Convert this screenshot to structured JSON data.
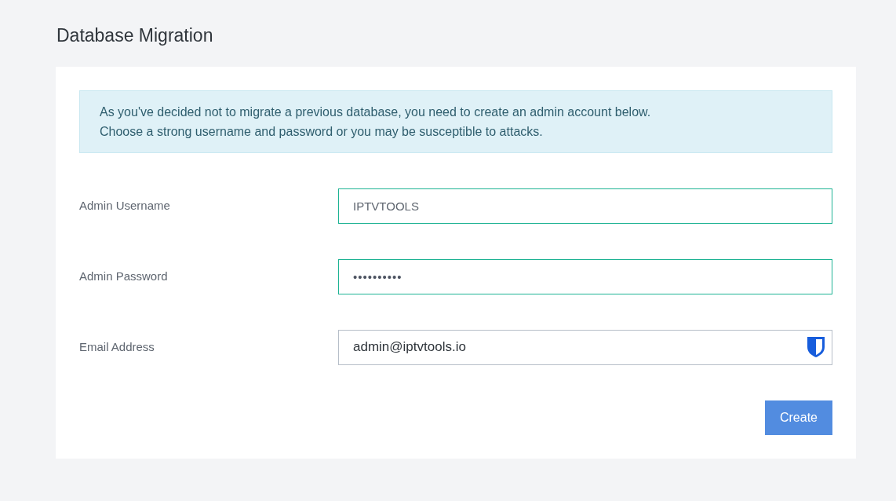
{
  "page": {
    "title": "Database Migration"
  },
  "notice": {
    "lines": [
      "As you've decided not to migrate a previous database, you need to create an admin account below.",
      "Choose a strong username and password or you may be susceptible to attacks."
    ]
  },
  "fields": [
    {
      "label": "Admin Username",
      "kind": "text",
      "value": "IPTVTOOLS",
      "valid": true
    },
    {
      "label": "Admin Password",
      "kind": "password",
      "value": "••••••••••",
      "valid": true
    },
    {
      "label": "Email Address",
      "kind": "email",
      "value": "admin@iptvtools.io",
      "valid": false
    }
  ],
  "buttons": [
    {
      "label": "Create"
    }
  ]
}
